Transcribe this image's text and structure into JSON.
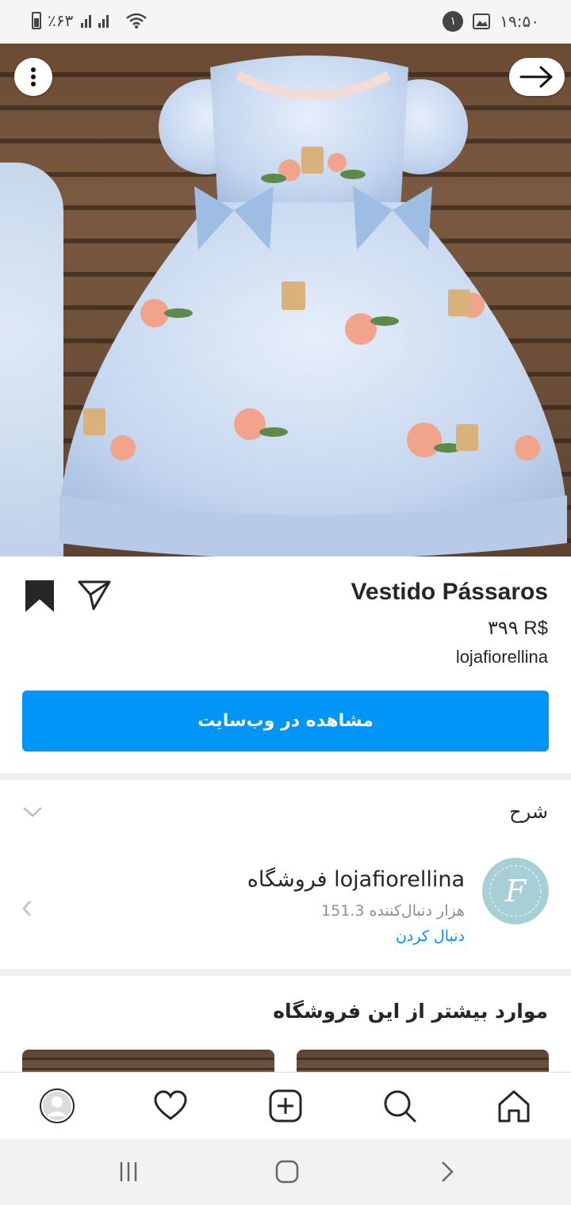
{
  "status_bar": {
    "battery_percent": "٪۶۳",
    "time": "۱۹:۵۰",
    "notification_count": "۱"
  },
  "product": {
    "title": "Vestido Pássaros",
    "price": "۳۹۹ R$",
    "seller": "lojafiorellina",
    "cta_label": "مشاهده در وب‌سایت"
  },
  "description": {
    "label": "شرح"
  },
  "shop": {
    "label": "فروشگاه",
    "name": "lojafiorellina",
    "followers": "151.3 هزار دنبال‌کننده",
    "follow_label": "دنبال کردن",
    "avatar_letter": "F"
  },
  "more_section": {
    "title": "موارد بیشتر از این فروشگاه"
  },
  "bottom_nav": {
    "items": [
      "profile-icon",
      "heart-icon",
      "add-icon",
      "search-icon",
      "home-icon"
    ]
  },
  "colors": {
    "accent": "#0095f6",
    "text": "#262626",
    "muted": "#8e8e8e"
  }
}
